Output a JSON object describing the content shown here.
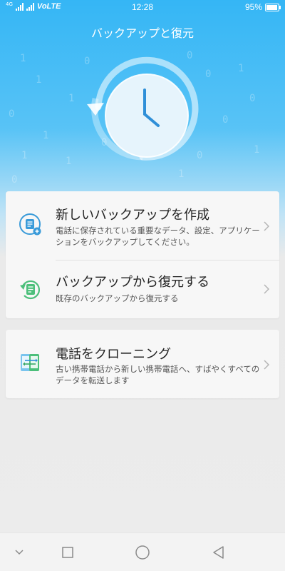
{
  "status_bar": {
    "network": "4G",
    "carrier_label": "VoLTE",
    "time": "12:28",
    "battery": "95%",
    "battery_level": 0.95
  },
  "header": {
    "title": "バックアップと復元"
  },
  "hero": {
    "icon": "clock-restore-icon",
    "binary_digits": [
      "1",
      "0",
      "0",
      "1",
      "1",
      "0",
      "0",
      "1",
      "0",
      "1",
      "0",
      "0",
      "1",
      "1",
      "0",
      "1",
      "1",
      "0"
    ]
  },
  "options": [
    {
      "title": "新しいバックアップを作成",
      "description": "電話に保存されている重要なデータ、設定、アプリケーションをバックアップしてください。",
      "icon": "new-backup-icon"
    },
    {
      "title": "バックアップから復元する",
      "description": "既存のバックアップから復元する",
      "icon": "restore-icon"
    },
    {
      "title": "電話をクローニング",
      "description": "古い携帯電話から新しい携帯電話へ、すばやくすべてのデータを転送します",
      "icon": "phone-clone-icon"
    }
  ],
  "nav_bar": {
    "buttons": [
      "chevron-down-icon",
      "recents-square-icon",
      "home-circle-icon",
      "back-triangle-icon"
    ]
  },
  "colors": {
    "accent_blue": "#35b6f5",
    "icon_blue": "#3a9bd9",
    "icon_green": "#4cbf7a"
  }
}
